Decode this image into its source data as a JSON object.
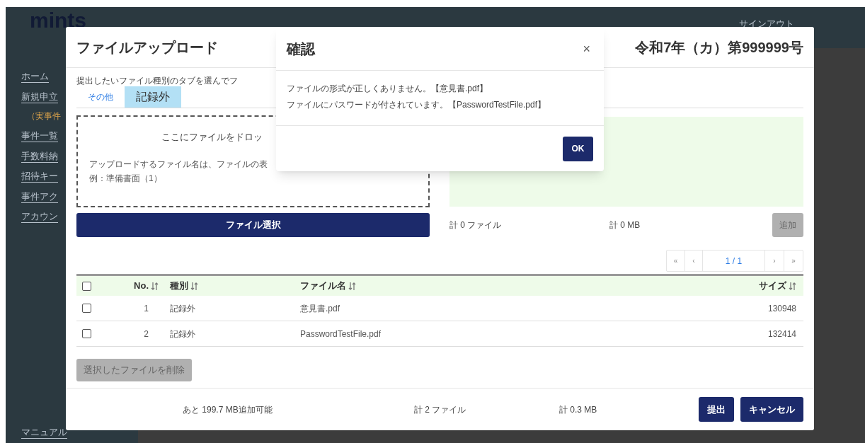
{
  "app": {
    "logo": "mints",
    "user_links": [
      "サインアウト"
    ],
    "sidebar": {
      "items": [
        {
          "label": "ホーム",
          "kind": "link"
        },
        {
          "label": "新規申立",
          "kind": "link"
        },
        {
          "label": "（実事件",
          "kind": "note"
        },
        {
          "label": "事件一覧",
          "kind": "link"
        },
        {
          "label": "手数料納",
          "kind": "link"
        },
        {
          "label": "招待キー",
          "kind": "link"
        },
        {
          "label": "事件アク",
          "kind": "link"
        },
        {
          "label": "アカウン",
          "kind": "link"
        }
      ],
      "bottom_link": "マニュアル"
    }
  },
  "upload_dialog": {
    "title": "ファイルアップロード",
    "case_number": "令和7年（カ）第999999号",
    "instruction": "提出したいファイル種別のタブを選んでフ",
    "tabs": [
      {
        "label": "その他",
        "selected": false
      },
      {
        "label": "記録外",
        "selected": true
      }
    ],
    "dropzone": {
      "title": "ここにファイルをドロッ",
      "note": "アップロードするファイル名は、ファイルの表",
      "example": "例：準備書面（1）"
    },
    "select_button": "ファイル選択",
    "staged": {
      "file_count": "計 0 ファイル",
      "size_total": "計 0 MB",
      "add_button": {
        "label": "追加",
        "disabled": true
      }
    },
    "pagination": {
      "first": "«",
      "prev": "‹",
      "page": "1 / 1",
      "next": "›",
      "last": "»"
    },
    "table": {
      "header_checked": false,
      "columns": [
        "No.",
        "種別",
        "ファイル名",
        "サイズ"
      ],
      "rows": [
        {
          "checked": false,
          "cells": [
            "1",
            "記録外",
            "意見書.pdf",
            "130948"
          ]
        },
        {
          "checked": false,
          "cells": [
            "2",
            "記録外",
            "PasswordTestFile.pdf",
            "132414"
          ]
        }
      ]
    },
    "delete_button": {
      "label": "選択したファイルを削除",
      "disabled": true
    },
    "footer": {
      "remaining": "あと 199.7 MB追加可能",
      "file_count": "計 2 ファイル",
      "size_total": "計 0.3 MB"
    },
    "buttons": [
      "提出",
      "キャンセル"
    ]
  },
  "confirm_dialog": {
    "title": "確認",
    "close": "×",
    "messages": [
      "ファイルの形式が正しくありません。【意見書.pdf】",
      "ファイルにパスワードが付されています。【PasswordTestFile.pdf】"
    ],
    "ok": "OK"
  }
}
